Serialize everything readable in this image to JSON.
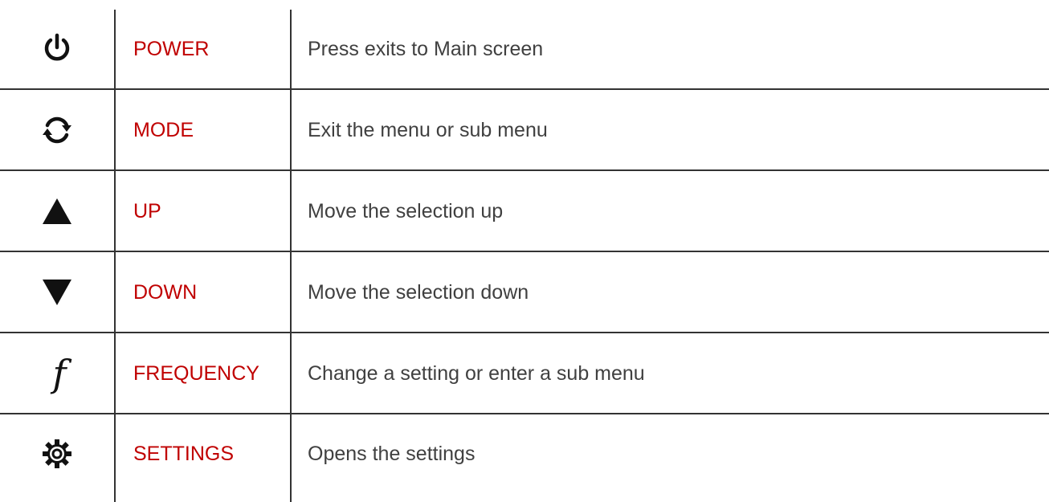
{
  "rows": [
    {
      "icon": "power-icon",
      "key": "POWER",
      "description": "Press exits to Main screen"
    },
    {
      "icon": "mode-cycle-icon",
      "key": "MODE",
      "description": "Exit the menu or sub menu"
    },
    {
      "icon": "up-triangle-icon",
      "key": "UP",
      "description": "Move the selection up"
    },
    {
      "icon": "down-triangle-icon",
      "key": "DOWN",
      "description": "Move the selection down"
    },
    {
      "icon": "frequency-f-icon",
      "icon_glyph": "f",
      "key": "FREQUENCY",
      "description": "Change a setting or enter a sub menu"
    },
    {
      "icon": "settings-gear-icon",
      "key": "SETTINGS",
      "description": "Opens the settings"
    }
  ],
  "colors": {
    "key_text": "#c00000",
    "description_text": "#404040",
    "grid_lines": "#333333",
    "icon": "#111111"
  }
}
